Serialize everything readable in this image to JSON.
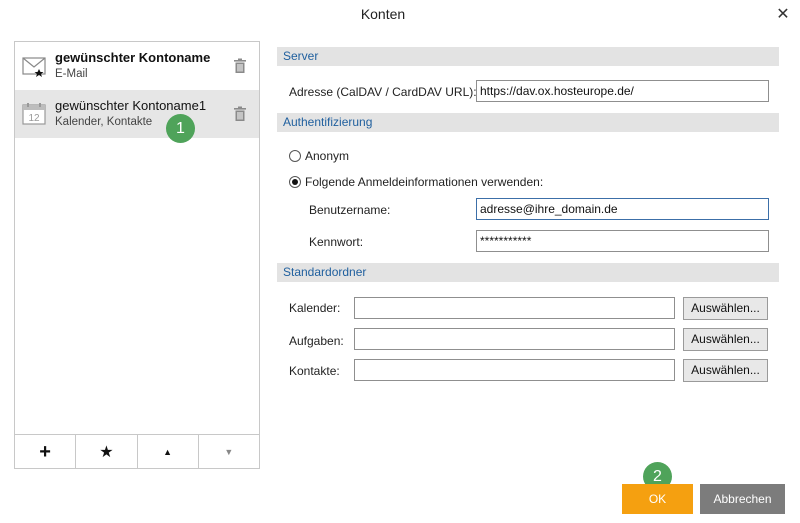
{
  "dialog": {
    "title": "Konten",
    "close_icon": "close-icon"
  },
  "accounts": [
    {
      "name": "gewünschter Kontoname",
      "subtitle": "E-Mail",
      "icon": "mail-default-icon",
      "selected": false
    },
    {
      "name": "gewünschter Kontoname1",
      "subtitle": "Kalender, Kontakte",
      "icon": "calendar-icon",
      "selected": true
    }
  ],
  "badges": {
    "first": "1",
    "second": "2"
  },
  "toolbar": {
    "add_label": "+",
    "star_label": "★",
    "up_label": "▲",
    "down_label": "▼"
  },
  "server": {
    "section_label": "Server",
    "address_label": "Adresse (CalDAV / CardDAV URL):",
    "address_value": "https://dav.ox.hosteurope.de/"
  },
  "auth": {
    "section_label": "Authentifizierung",
    "anonymous_label": "Anonym",
    "credentials_label": "Folgende Anmeldeinformationen verwenden:",
    "selected_option": "credentials",
    "username_label": "Benutzername:",
    "username_value": "adresse@ihre_domain.de",
    "password_label": "Kennwort:",
    "password_value": "***********"
  },
  "default_folders": {
    "section_label": "Standardordner",
    "calendar_label": "Kalender:",
    "calendar_value": "",
    "tasks_label": "Aufgaben:",
    "tasks_value": "",
    "contacts_label": "Kontakte:",
    "contacts_value": "",
    "choose_label": "Auswählen..."
  },
  "footer": {
    "ok_label": "OK",
    "cancel_label": "Abbrechen"
  },
  "colors": {
    "accent_orange": "#f5a010",
    "badge_green": "#4fa35a",
    "section_text": "#1f5f9e",
    "cancel_gray": "#7c7c7c"
  }
}
